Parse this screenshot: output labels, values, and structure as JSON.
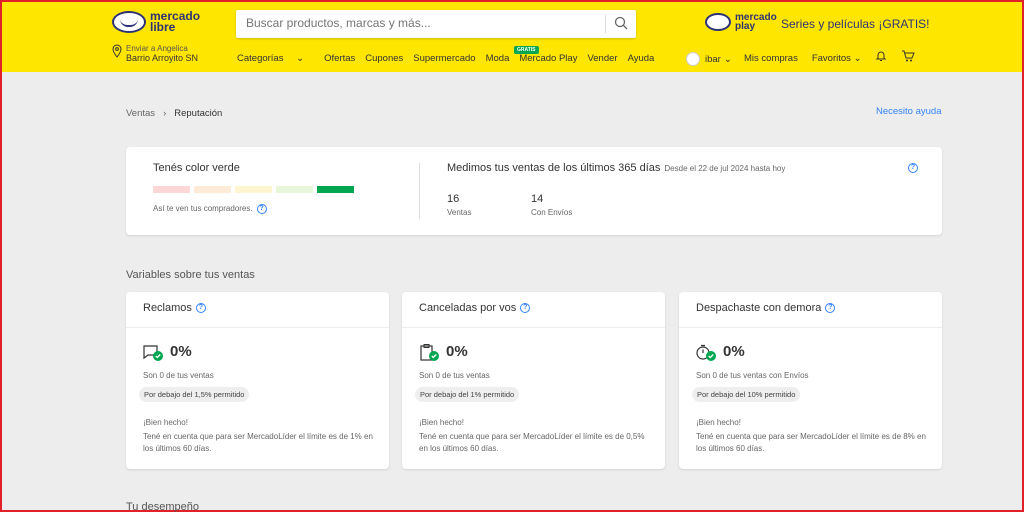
{
  "header": {
    "logo_line1": "mercado",
    "logo_line2": "libre",
    "search_placeholder": "Buscar productos, marcas y más...",
    "play_logo_line1": "mercado",
    "play_logo_line2": "play",
    "promo": "Series y películas ¡GRATIS!",
    "location_top": "Enviar a Angelica",
    "location_bottom": "Barrio Arroyito SN",
    "nav": [
      "Categorías",
      "Ofertas",
      "Cupones",
      "Supermercado",
      "Moda",
      "Mercado Play",
      "Vender",
      "Ayuda"
    ],
    "gratis_badge": "GRATIS",
    "user": "ibar",
    "my_purchases": "Mis compras",
    "favorites": "Favoritos"
  },
  "breadcrumb": {
    "parent": "Ventas",
    "current": "Reputación"
  },
  "help_link": "Necesito ayuda",
  "reputation": {
    "title": "Tenés color verde",
    "thermometer_colors": [
      "#fdd7d7",
      "#fdebd8",
      "#fdf6d1",
      "#e8f6d9",
      "#00a650"
    ],
    "subtitle": "Así te ven tus compradores.",
    "sales_title": "Medimos tus ventas de los últimos 365 días",
    "sales_date": "Desde el 22 de jul 2024 hasta hoy",
    "sales_count": "16",
    "sales_label": "Ventas",
    "shipments_count": "14",
    "shipments_label": "Con Envíos"
  },
  "variables_title": "Variables sobre tus ventas",
  "variables": [
    {
      "title": "Reclamos",
      "pct": "0%",
      "sub": "Son 0 de tus ventas",
      "pill": "Por debajo del 1,5% permitido",
      "bien": "¡Bien hecho!",
      "note": "Tené en cuenta que para ser MercadoLíder el límite es de 1% en los últimos 60 días."
    },
    {
      "title": "Canceladas por vos",
      "pct": "0%",
      "sub": "Son 0 de tus ventas",
      "pill": "Por debajo del 1% permitido",
      "bien": "¡Bien hecho!",
      "note": "Tené en cuenta que para ser MercadoLíder el límite es de 0,5% en los últimos 60 días."
    },
    {
      "title": "Despachaste con demora",
      "pct": "0%",
      "sub": "Son 0 de tus ventas con Envíos",
      "pill": "Por debajo del 10% permitido",
      "bien": "¡Bien hecho!",
      "note": "Tené en cuenta que para ser MercadoLíder el límite es de 8% en los últimos 60 días."
    }
  ],
  "performance_title": "Tu desempeño"
}
